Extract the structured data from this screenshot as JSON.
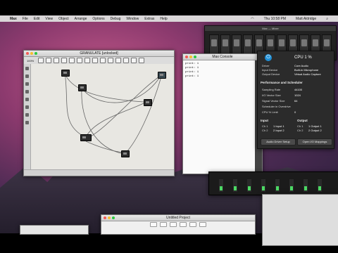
{
  "menubar": {
    "app": "Max",
    "items": [
      "File",
      "Edit",
      "View",
      "Object",
      "Arrange",
      "Options",
      "Debug",
      "Window",
      "Extras",
      "Help"
    ],
    "clock": "Thu 10:58 PM",
    "user": "Matt Aldridge"
  },
  "patcher": {
    "title": "GRANULATE [unlocked]",
    "zoom": "100%"
  },
  "console": {
    "title": "Max Console",
    "lines": [
      "print: 1",
      "print: 1",
      "print: 1",
      "print: 1"
    ]
  },
  "mixer": {
    "title": "Max — Mixer"
  },
  "audio_status": {
    "cpu_label": "CPU",
    "cpu_value": "1 %",
    "driver_label": "Driver",
    "driver_value": "Core Audio",
    "input_label": "Input Device",
    "input_value": "Built-in Microphone",
    "output_label": "Output Device",
    "output_value": "Virtual Audio Capture",
    "perf_section": "Performance and Scheduler",
    "sr_label": "Sampling Rate",
    "sr_value": "44100",
    "io_label": "I/O Vector Size",
    "io_value": "1024",
    "sv_label": "Signal Vector Size",
    "sv_value": "64",
    "sched_label": "Scheduler in Overdrive",
    "cpu_limit_label": "CPU % Limit",
    "cpu_limit_value": "0",
    "input_section": "Input",
    "output_section": "Output",
    "in_ch1": "Ch 1",
    "in_ch1_val": "1 Input 1",
    "in_ch2": "Ch 2",
    "in_ch2_val": "2 Input 2",
    "out_ch1": "Ch 1",
    "out_ch1_val": "1 Output 1",
    "out_ch2": "Ch 2",
    "out_ch2_val": "2 Output 2",
    "driver_setup_btn": "Audio Driver Setup",
    "io_map_btn": "Open I/O Mappings"
  },
  "finder": {
    "title": "Untitled Project"
  },
  "accent_colors": {
    "power": "#1f8fd6",
    "meter": "#4cd964"
  }
}
